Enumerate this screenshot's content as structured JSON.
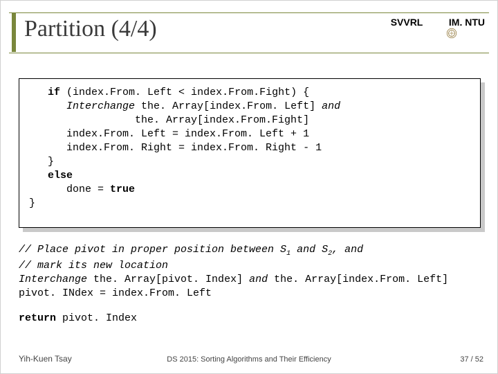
{
  "colors": {
    "accent": "#7a873c",
    "rule": "#7a873c"
  },
  "header": {
    "title": "Partition (4/4)",
    "brand_left": "SVVRL ",
    "brand_right": " IM. NTU"
  },
  "code": {
    "l1_pre": "   ",
    "l1_kw": "if",
    "l1_rest": " (index.From. Left < index.From.Fight) {",
    "l2_pre": "      ",
    "l2_em": "Interchange",
    "l2_rest1": " the. Array[index.From. Left] ",
    "l2_em2": "and",
    "l3": "                 the. Array[index.From.Fight]",
    "l4": "      index.From. Left = index.From. Left + 1",
    "l5": "      index.From. Right = index.From. Right - 1",
    "l6": "   }",
    "l7_pre": "   ",
    "l7_kw": "else",
    "l8_pre": "      done = ",
    "l8_kw": "true",
    "l9": "}"
  },
  "below": {
    "c1_em": "// Place pivot in proper position between S",
    "c1_sub": "1",
    "c1_em2": " and S",
    "c1_sub2": "2",
    "c1_em3": ", and",
    "c2_em": "// mark its new location",
    "l1_em1": "Interchange",
    "l1_mid": " the. Array[pivot. Index] ",
    "l1_em2": "and",
    "l1_rest": " the. Array[index.From. Left]",
    "l2": "pivot. INdex = index.From. Left"
  },
  "ret": {
    "kw": "return",
    "rest": " pivot. Index"
  },
  "footer": {
    "author": "Yih-Kuen Tsay",
    "course": "DS 2015: Sorting Algorithms and Their Efficiency",
    "page_cur": "37 ",
    "page_sep": "/",
    "page_total": " 52"
  }
}
